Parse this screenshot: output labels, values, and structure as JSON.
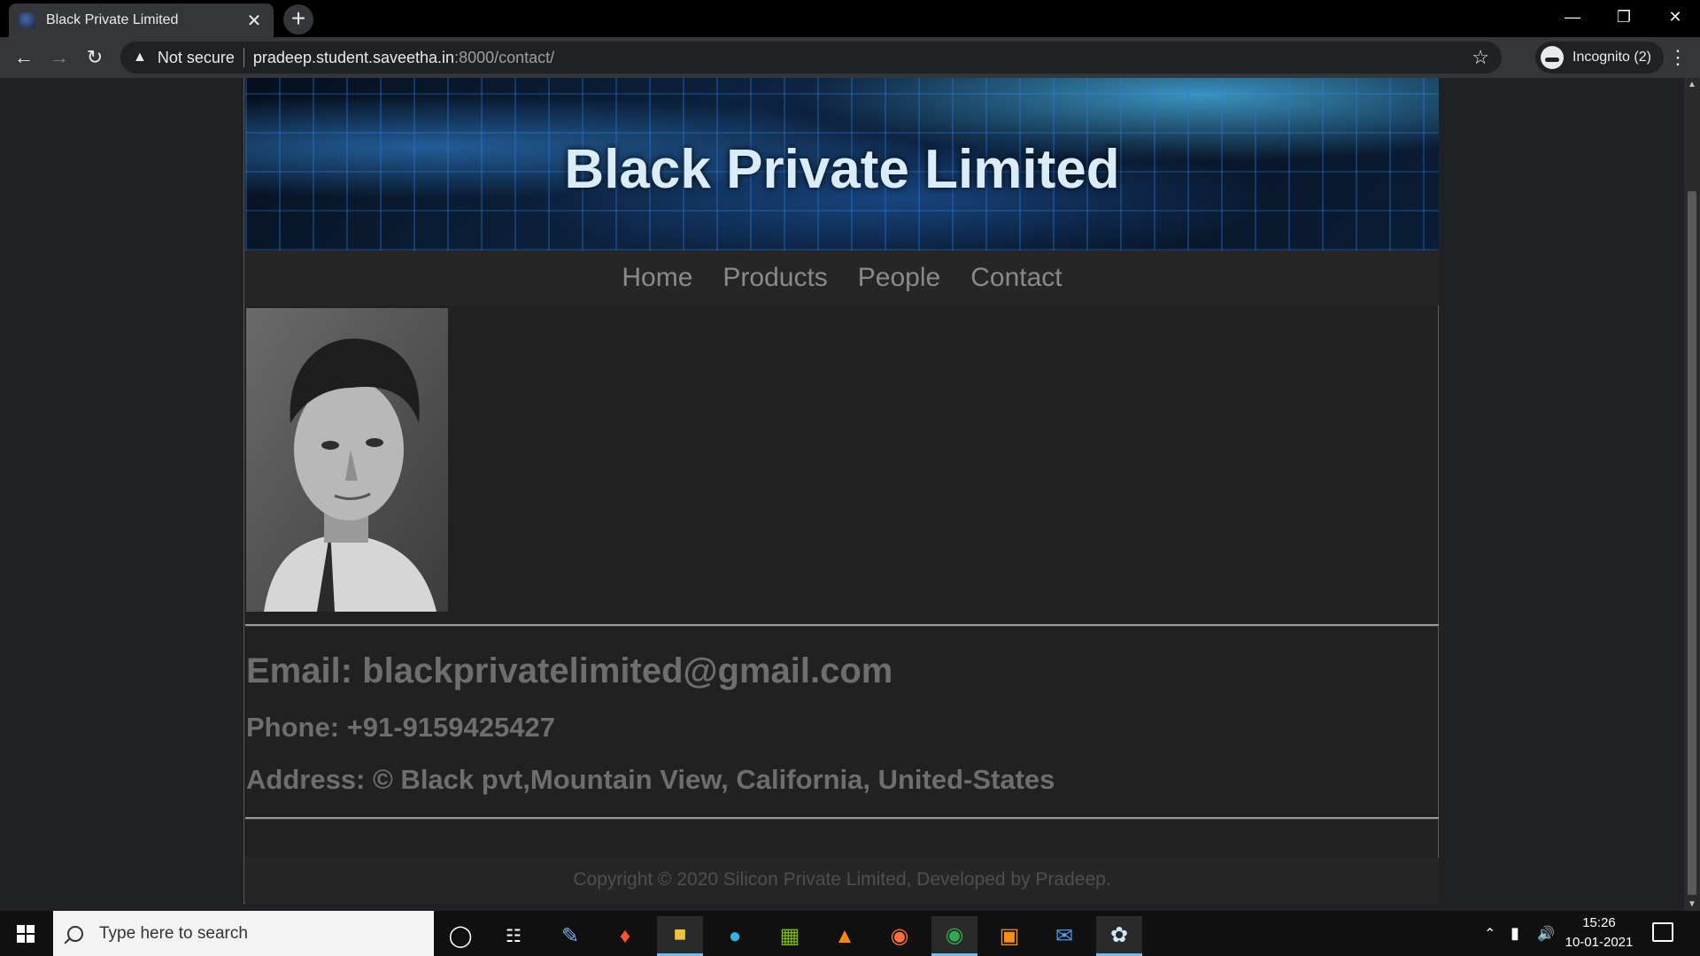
{
  "browser": {
    "tab_title": "Black Private Limited",
    "tab_close": "✕",
    "new_tab": "+",
    "security_label": "Not secure",
    "url_host": "pradeep.student.saveetha.in",
    "url_path": ":8000/contact/",
    "incognito_label": "Incognito (2)"
  },
  "site": {
    "title": "Black Private Limited",
    "nav": [
      "Home",
      "Products",
      "People",
      "Contact"
    ],
    "email": "Email: blackprivatelimited@gmail.com",
    "phone": "Phone: +91-9159425427",
    "address": "Address: © Black pvt,Mountain View, California, United-States",
    "footer": "Copyright © 2020 Silicon Private Limited, Developed by Pradeep."
  },
  "taskbar": {
    "search_placeholder": "Type here to search",
    "time": "15:26",
    "date": "10-01-2021"
  },
  "colors": {
    "page_bg": "#212121",
    "nav_link": "#8a8a8a",
    "contact_text": "#6e6e6e",
    "footer_text": "#4f4f4f"
  },
  "icons": [
    "back-icon",
    "forward-icon",
    "reload-icon",
    "warning-icon",
    "star-icon",
    "incognito-icon",
    "menu-icon"
  ]
}
